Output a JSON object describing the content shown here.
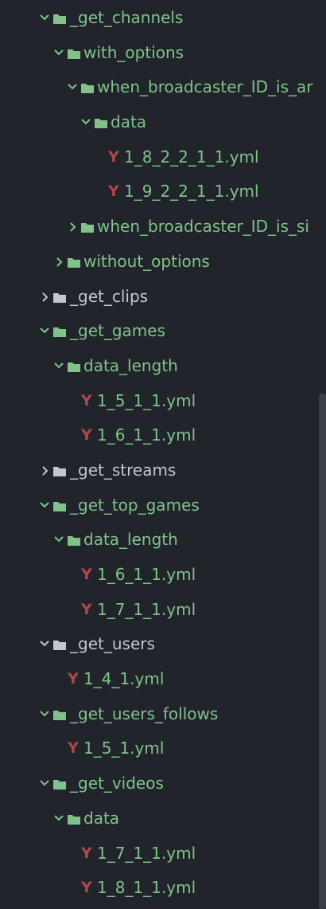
{
  "tree": {
    "items": [
      {
        "label": "_get_channels",
        "state": "open",
        "color": "green"
      },
      {
        "label": "with_options",
        "state": "open",
        "color": "green"
      },
      {
        "label": "when_broadcaster_ID_is_ar",
        "state": "open",
        "color": "green"
      },
      {
        "label": "data",
        "state": "open",
        "color": "green"
      },
      {
        "label": "1_8_2_2_1_1.yml",
        "state": "file",
        "color": "green"
      },
      {
        "label": "1_9_2_2_1_1.yml",
        "state": "file",
        "color": "green"
      },
      {
        "label": "when_broadcaster_ID_is_si",
        "state": "closed",
        "color": "green"
      },
      {
        "label": "without_options",
        "state": "closed",
        "color": "green"
      },
      {
        "label": "_get_clips",
        "state": "closed",
        "color": "grey"
      },
      {
        "label": "_get_games",
        "state": "open",
        "color": "green"
      },
      {
        "label": "data_length",
        "state": "open",
        "color": "green"
      },
      {
        "label": "1_5_1_1.yml",
        "state": "file",
        "color": "green"
      },
      {
        "label": "1_6_1_1.yml",
        "state": "file",
        "color": "green"
      },
      {
        "label": "_get_streams",
        "state": "closed",
        "color": "grey"
      },
      {
        "label": "_get_top_games",
        "state": "open",
        "color": "green"
      },
      {
        "label": "data_length",
        "state": "open",
        "color": "green"
      },
      {
        "label": "1_6_1_1.yml",
        "state": "file",
        "color": "green"
      },
      {
        "label": "1_7_1_1.yml",
        "state": "file",
        "color": "green"
      },
      {
        "label": "_get_users",
        "state": "open",
        "color": "grey"
      },
      {
        "label": "1_4_1.yml",
        "state": "file",
        "color": "green"
      },
      {
        "label": "_get_users_follows",
        "state": "open",
        "color": "green"
      },
      {
        "label": "1_5_1.yml",
        "state": "file",
        "color": "green"
      },
      {
        "label": "_get_videos",
        "state": "open",
        "color": "green"
      },
      {
        "label": "data",
        "state": "open",
        "color": "green"
      },
      {
        "label": "1_7_1_1.yml",
        "state": "file",
        "color": "green"
      },
      {
        "label": "1_8_1_1.yml",
        "state": "file",
        "color": "green"
      }
    ]
  },
  "icons": {
    "yaml_glyph": "Y",
    "folder": "folder-icon",
    "chevron_open": "chevron-down-icon",
    "chevron_closed": "chevron-right-icon"
  },
  "colors": {
    "background": "#21252b",
    "modified_green": "#80c28a",
    "default_grey": "#c1c6cf",
    "yaml_red": "#b0454d",
    "scrollbar": "#3a3f47"
  }
}
